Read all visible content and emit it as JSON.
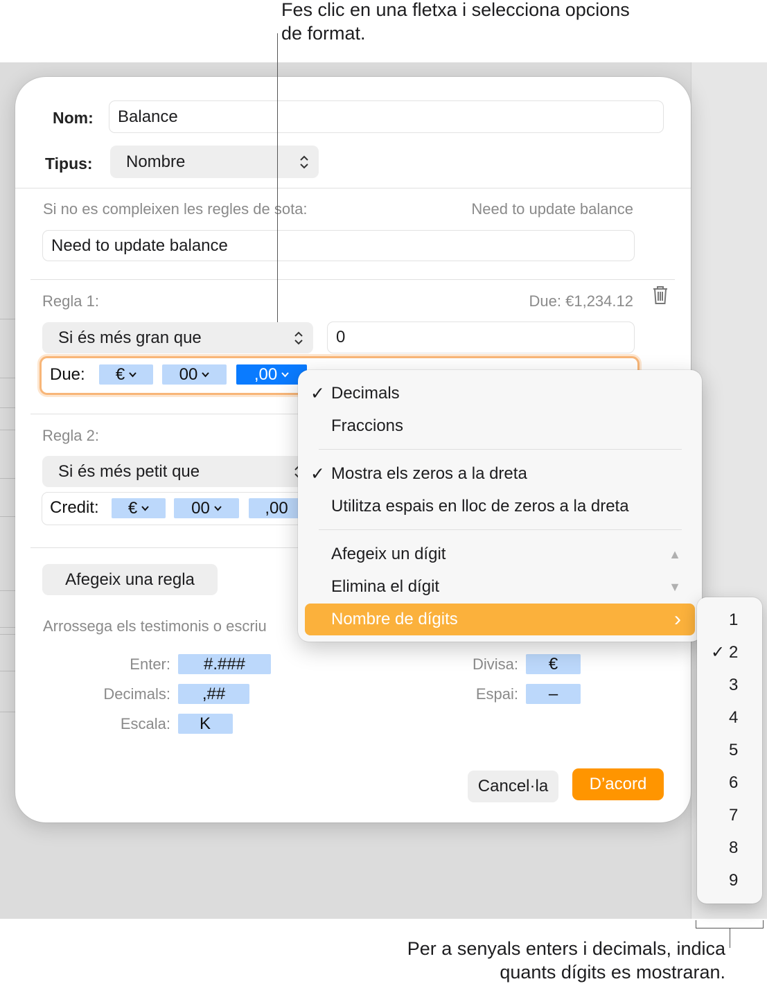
{
  "callouts": {
    "top": "Fes clic en una fletxa i selecciona opcions de format.",
    "bottom": "Per a senyals enters i decimals, indica quants dígits es mostraran."
  },
  "dialog": {
    "name_label": "Nom:",
    "name_value": "Balance",
    "type_label": "Tipus:",
    "type_value": "Nombre",
    "fallback_label": "Si no es compleixen les regles de sota:",
    "fallback_preview": "Need to update balance",
    "fallback_value": "Need to update balance",
    "rule1": {
      "label": "Regla 1:",
      "preview": "Due: €1,234.12",
      "condition": "Si és més gran que",
      "value": "0",
      "format_label": "Due:",
      "tokens": [
        "€",
        "00",
        ",00"
      ]
    },
    "rule2": {
      "label": "Regla 2:",
      "condition": "Si és més petit que",
      "format_label": "Credit:",
      "tokens": [
        "€",
        "00",
        ",00"
      ]
    },
    "add_rule": "Afegeix una regla",
    "drag_hint": "Arrossega els testimonis o escriu",
    "tokens_left": [
      {
        "label": "Enter:",
        "token": "#.###"
      },
      {
        "label": "Decimals:",
        "token": ",##"
      },
      {
        "label": "Escala:",
        "token": "K"
      }
    ],
    "tokens_right": [
      {
        "label": "Divisa:",
        "token": "€"
      },
      {
        "label": "Espai:",
        "token": "–"
      }
    ],
    "cancel": "Cancel·la",
    "ok": "D’acord"
  },
  "menu": {
    "items": [
      {
        "label": "Decimals",
        "checked": true
      },
      {
        "label": "Fraccions",
        "checked": false
      },
      {
        "label": "Mostra els zeros a la dreta",
        "checked": true
      },
      {
        "label": "Utilitza espais en lloc de zeros a la dreta",
        "checked": false
      },
      {
        "label": "Afegeix un dígit",
        "arrow": "▲"
      },
      {
        "label": "Elimina el dígit",
        "arrow": "▼"
      },
      {
        "label": "Nombre de dígits",
        "arrow": "›"
      }
    ],
    "check_mark": "✓"
  },
  "submenu": {
    "items": [
      "1",
      "2",
      "3",
      "4",
      "5",
      "6",
      "7",
      "8",
      "9"
    ],
    "selected": "2"
  },
  "colors": {
    "accent_orange": "#fbb13c",
    "ok_button": "#ff9500",
    "token_blue": "#bcd8fb",
    "token_active": "#0a7bff"
  }
}
